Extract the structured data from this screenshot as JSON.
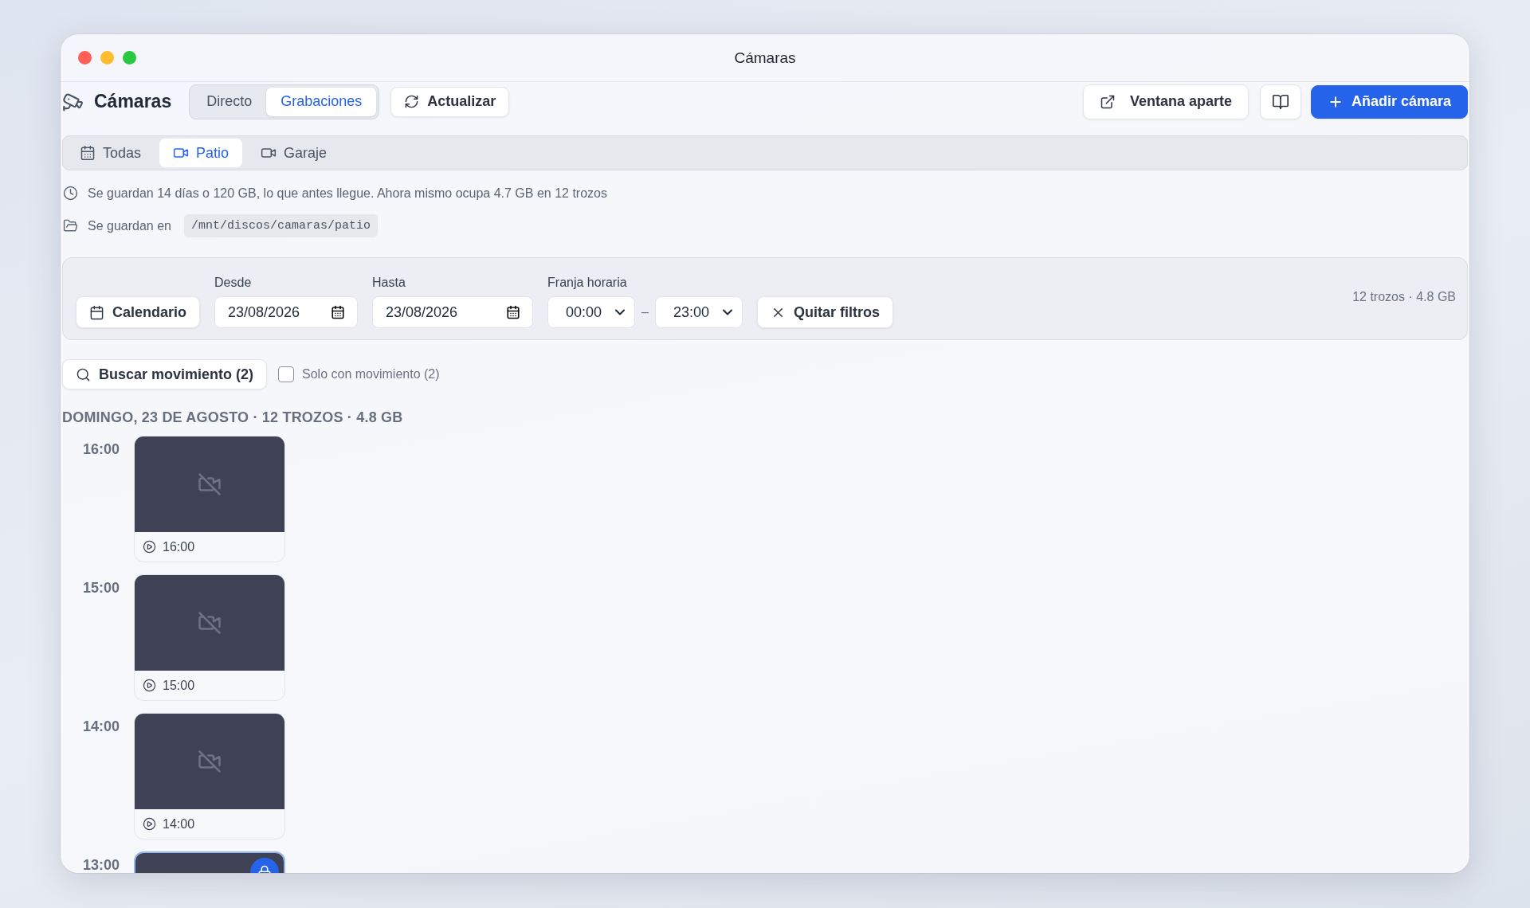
{
  "window": {
    "title": "Cámaras"
  },
  "app": {
    "title": "Cámaras"
  },
  "view_tabs": [
    {
      "label": "Directo",
      "selected": false
    },
    {
      "label": "Grabaciones",
      "selected": true
    }
  ],
  "refresh_button": "Actualizar",
  "actions": {
    "detach_button": "Ventana aparte",
    "add_button": "Añadir cámara"
  },
  "camera_tabs": [
    {
      "label": "Todas",
      "kind": "all",
      "selected": false
    },
    {
      "label": "Patio",
      "kind": "camera",
      "selected": true
    },
    {
      "label": "Garaje",
      "kind": "camera",
      "selected": false
    }
  ],
  "retention_note": "Se guardan 14 días o 120 GB, lo que antes llegue. Ahora mismo ocupa 4.7 GB en 12 trozos",
  "storage": {
    "label": "Se guardan en",
    "path": "/mnt/discos/camaras/patio"
  },
  "filters": {
    "calendar_button": "Calendario",
    "from": {
      "label": "Desde",
      "value": "23/08/2026"
    },
    "to": {
      "label": "Hasta",
      "value": "23/08/2026"
    },
    "time_range": {
      "label": "Franja horaria",
      "start": "00:00",
      "separator": "–",
      "end": "23:00"
    },
    "clear_button": "Quitar filtros",
    "summary": "12 trozos · 4.8 GB"
  },
  "motion": {
    "search_button": "Buscar movimiento (2)",
    "only_motion": {
      "label": "Solo con movimiento (2)",
      "checked": false
    }
  },
  "day_heading": "DOMINGO, 23 DE AGOSTO · 12 TROZOS · 4.8 GB",
  "segments": [
    {
      "hour": "16:00",
      "time": "16:00",
      "locked": false,
      "selected": false
    },
    {
      "hour": "15:00",
      "time": "15:00",
      "locked": false,
      "selected": false
    },
    {
      "hour": "14:00",
      "time": "14:00",
      "locked": false,
      "selected": false
    },
    {
      "hour": "13:00",
      "locked": true,
      "selected": true
    }
  ]
}
